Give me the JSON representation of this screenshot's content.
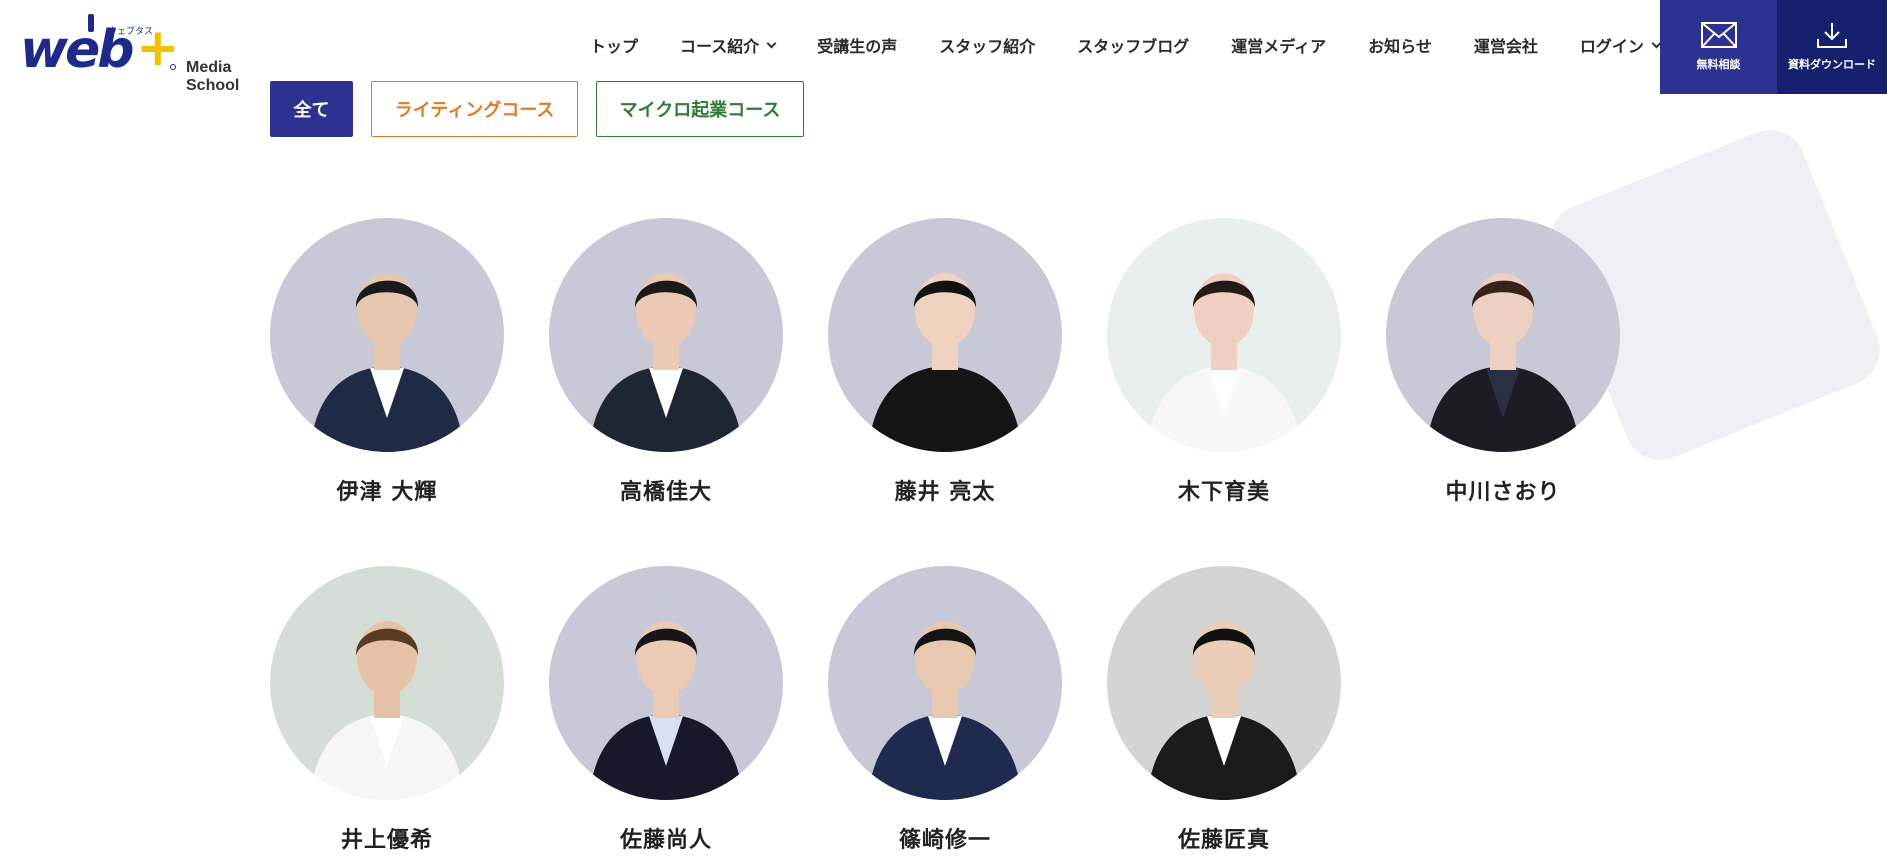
{
  "logo": {
    "main": "web",
    "kana": "ウェブタス",
    "sub": "Media School"
  },
  "nav": [
    {
      "label": "トップ",
      "dropdown": false
    },
    {
      "label": "コース紹介",
      "dropdown": true
    },
    {
      "label": "受講生の声",
      "dropdown": false
    },
    {
      "label": "スタッフ紹介",
      "dropdown": false
    },
    {
      "label": "スタッフブログ",
      "dropdown": false
    },
    {
      "label": "運営メディア",
      "dropdown": false
    },
    {
      "label": "お知らせ",
      "dropdown": false
    },
    {
      "label": "運営会社",
      "dropdown": false
    },
    {
      "label": "ログイン",
      "dropdown": true
    }
  ],
  "cta": {
    "consult": "無料相談",
    "download": "資料ダウンロード"
  },
  "filters": {
    "all": "全て",
    "writing": "ライティングコース",
    "micro": "マイクロ起業コース"
  },
  "staff": [
    {
      "name": "伊津 大輝",
      "bg": "#c9c8d6",
      "skin": "#e8c7b0",
      "hair": "#1a1a1a",
      "suit": "#1f2a44",
      "shirt": "#ffffff"
    },
    {
      "name": "高橋佳大",
      "bg": "#c9c8d6",
      "skin": "#ecc9b2",
      "hair": "#1a1a1a",
      "suit": "#1f2633",
      "shirt": "#ffffff"
    },
    {
      "name": "藤井 亮太",
      "bg": "#c9c8d6",
      "skin": "#efd2c0",
      "hair": "#121212",
      "suit": "#141414",
      "shirt": "#141414"
    },
    {
      "name": "木下育美",
      "bg": "#e9eeee",
      "skin": "#f0cfc2",
      "hair": "#241a16",
      "suit": "#f7f7f5",
      "shirt": "#ffffff"
    },
    {
      "name": "中川さおり",
      "bg": "#c9c8d6",
      "skin": "#edd0c2",
      "hair": "#3a2218",
      "suit": "#1c1c24",
      "shirt": "#2a2f44"
    },
    {
      "name": "井上優希",
      "bg": "#d4ded6",
      "skin": "#e8c2a8",
      "hair": "#5a3a22",
      "suit": "#f6f6f4",
      "shirt": "#ffffff"
    },
    {
      "name": "佐藤尚人",
      "bg": "#c9c8d6",
      "skin": "#ebcbb5",
      "hair": "#161616",
      "suit": "#17182a",
      "shirt": "#d8e2f0"
    },
    {
      "name": "篠崎修一",
      "bg": "#c9c8d6",
      "skin": "#e9c8b2",
      "hair": "#141414",
      "suit": "#1e2a4e",
      "shirt": "#ffffff"
    },
    {
      "name": "佐藤匠真",
      "bg": "#d4d4d4",
      "skin": "#ebcdb8",
      "hair": "#0f0f0f",
      "suit": "#1b1b1b",
      "shirt": "#ffffff"
    }
  ],
  "colors": {
    "primary": "#2d3190",
    "dark": "#15206e",
    "writing": "#e07a28",
    "micro": "#2e7d32"
  }
}
